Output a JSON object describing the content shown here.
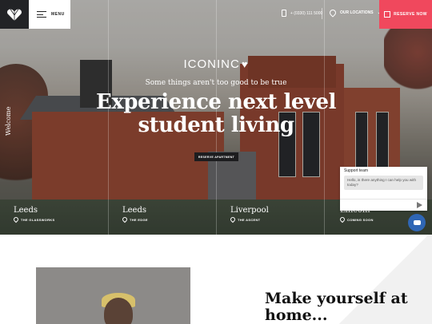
{
  "header": {
    "menu_label": "MENU",
    "phone": "+ (0330) 111 5000",
    "locations_label": "OUR LOCATIONS",
    "reserve_label": "RESERVE NOW",
    "reserve_color": "#f0485d"
  },
  "hero": {
    "brand": "ICONINC",
    "tagline": "Some things aren't too good to be true",
    "headline_line1": "Experience next level",
    "headline_line2": "student living",
    "cta": "RESERVE APARTMENT",
    "side_label": "Welcome",
    "locations": [
      {
        "city": "Leeds",
        "property": "THE GLASSWORKS"
      },
      {
        "city": "Leeds",
        "property": "THE EDGE"
      },
      {
        "city": "Liverpool",
        "property": "THE ASCENT"
      },
      {
        "city": "Lincoln",
        "property": "COMING SOON"
      }
    ]
  },
  "chat": {
    "title": "Support team",
    "message": "Hello, is there anything I can help you with today?",
    "placeholder": ""
  },
  "about": {
    "heading_line1": "Make yourself at",
    "heading_line2": "home..."
  }
}
